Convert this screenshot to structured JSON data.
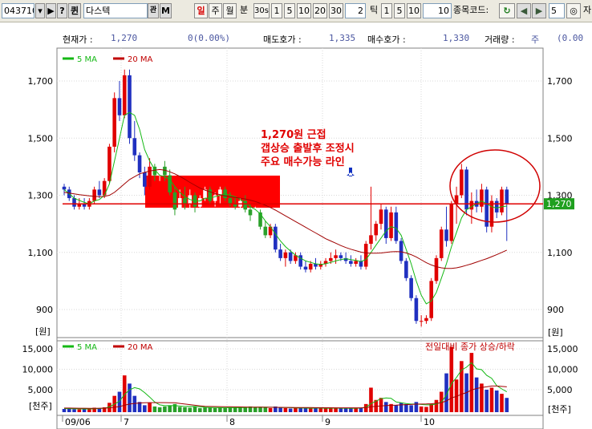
{
  "toolbar": {
    "code_value": "043710",
    "code_buttons": [
      "▾",
      "▶",
      "?",
      "퀸"
    ],
    "stock_name": "다스텍",
    "name_buttons": [
      "관",
      "M"
    ],
    "period_tabs": [
      "일",
      "주",
      "월",
      "분"
    ],
    "interval_30": "30",
    "interval_suffix": "s",
    "intervals": [
      "1",
      "5",
      "10",
      "20",
      "30"
    ],
    "tick_value": "2",
    "tick_label": "틱",
    "tick_intervals": [
      "1",
      "5",
      "10"
    ],
    "count_value": "10",
    "code_label": "종목코드:",
    "refresh_icon": "refresh-icon",
    "nav_prev": "◀",
    "nav_next": "▶",
    "zoom_value": "5",
    "search_icon": "search-icon",
    "tail_label": "자"
  },
  "info": {
    "current_label": "현재가 :",
    "current_value": "1,270",
    "change_value": "0(0.00%)",
    "ask_label": "매도호가 :",
    "ask_value": "1,335",
    "bid_label": "매수호가 :",
    "bid_value": "1,330",
    "volume_label": "거래량 :",
    "volume_value": "주",
    "right_value": "(0.00"
  },
  "annotation": {
    "lines": [
      "1,270원 근접",
      "갭상승 출발후 조정시",
      "주요 매수가능 라인"
    ],
    "price_line": 1270,
    "price_tag": "1,270"
  },
  "chart_data": [
    {
      "type": "candlestick",
      "legend": [
        {
          "name": "5 MA",
          "color": "#14b814"
        },
        {
          "name": "20 MA",
          "color": "#c00000"
        }
      ],
      "y_ticks": [
        900,
        1100,
        1300,
        1500,
        1700
      ],
      "y_tick_labels": [
        "900",
        "1,100",
        "1,300",
        "1,500",
        "1,700"
      ],
      "ylim": [
        830,
        1780
      ],
      "unit_label": "[원]",
      "x_labels": [
        "09/06",
        "7",
        "8",
        "9",
        "10"
      ],
      "colors": {
        "up": "#e00000",
        "down": "#2030c0",
        "ma5": "#14b814",
        "ma20": "#a00000",
        "hline": "#e00000"
      },
      "candles": [
        [
          1330,
          1340,
          1300,
          1320
        ],
        [
          1320,
          1330,
          1280,
          1290
        ],
        [
          1290,
          1300,
          1250,
          1260
        ],
        [
          1260,
          1290,
          1250,
          1270
        ],
        [
          1270,
          1290,
          1250,
          1260
        ],
        [
          1260,
          1290,
          1250,
          1280
        ],
        [
          1280,
          1330,
          1270,
          1320
        ],
        [
          1320,
          1350,
          1290,
          1300
        ],
        [
          1300,
          1360,
          1290,
          1350
        ],
        [
          1350,
          1480,
          1340,
          1470
        ],
        [
          1470,
          1660,
          1450,
          1640
        ],
        [
          1640,
          1700,
          1560,
          1580
        ],
        [
          1580,
          1740,
          1570,
          1720
        ],
        [
          1720,
          1740,
          1480,
          1500
        ],
        [
          1500,
          1560,
          1420,
          1440
        ],
        [
          1440,
          1450,
          1360,
          1380
        ],
        [
          1380,
          1400,
          1300,
          1330
        ],
        [
          1330,
          1430,
          1320,
          1400
        ],
        [
          1400,
          1410,
          1350,
          1370
        ],
        [
          1370,
          1410,
          1350,
          1400
        ],
        [
          1400,
          1420,
          1350,
          1370
        ],
        [
          1370,
          1390,
          1300,
          1310
        ],
        [
          1310,
          1330,
          1230,
          1250
        ],
        [
          1250,
          1320,
          1230,
          1290
        ],
        [
          1290,
          1330,
          1250,
          1270
        ],
        [
          1270,
          1320,
          1250,
          1300
        ],
        [
          1300,
          1310,
          1240,
          1260
        ],
        [
          1260,
          1300,
          1250,
          1290
        ],
        [
          1290,
          1330,
          1280,
          1320
        ],
        [
          1320,
          1330,
          1270,
          1280
        ],
        [
          1280,
          1310,
          1260,
          1300
        ],
        [
          1300,
          1330,
          1270,
          1320
        ],
        [
          1320,
          1330,
          1280,
          1290
        ],
        [
          1290,
          1310,
          1260,
          1270
        ],
        [
          1270,
          1290,
          1250,
          1260
        ],
        [
          1260,
          1290,
          1240,
          1280
        ],
        [
          1280,
          1300,
          1240,
          1250
        ],
        [
          1250,
          1270,
          1210,
          1230
        ],
        [
          1230,
          1260,
          1200,
          1240
        ],
        [
          1240,
          1250,
          1180,
          1190
        ],
        [
          1190,
          1210,
          1150,
          1160
        ],
        [
          1160,
          1200,
          1150,
          1190
        ],
        [
          1190,
          1200,
          1100,
          1110
        ],
        [
          1110,
          1130,
          1070,
          1080
        ],
        [
          1080,
          1110,
          1050,
          1100
        ],
        [
          1100,
          1110,
          1060,
          1070
        ],
        [
          1070,
          1100,
          1060,
          1090
        ],
        [
          1090,
          1100,
          1040,
          1050
        ],
        [
          1050,
          1070,
          1030,
          1040
        ],
        [
          1040,
          1070,
          1030,
          1060
        ],
        [
          1060,
          1080,
          1040,
          1050
        ],
        [
          1050,
          1070,
          1040,
          1060
        ],
        [
          1060,
          1080,
          1050,
          1070
        ],
        [
          1070,
          1100,
          1060,
          1080
        ],
        [
          1080,
          1110,
          1060,
          1090
        ],
        [
          1090,
          1100,
          1070,
          1080
        ],
        [
          1080,
          1100,
          1060,
          1070
        ],
        [
          1070,
          1090,
          1050,
          1060
        ],
        [
          1060,
          1080,
          1050,
          1070
        ],
        [
          1070,
          1090,
          1040,
          1050
        ],
        [
          1050,
          1140,
          1040,
          1130
        ],
        [
          1130,
          1330,
          1110,
          1160
        ],
        [
          1160,
          1210,
          1140,
          1200
        ],
        [
          1200,
          1270,
          1180,
          1250
        ],
        [
          1250,
          1260,
          1130,
          1150
        ],
        [
          1150,
          1260,
          1140,
          1240
        ],
        [
          1240,
          1260,
          1130,
          1140
        ],
        [
          1140,
          1150,
          1060,
          1070
        ],
        [
          1070,
          1080,
          1000,
          1010
        ],
        [
          1010,
          1020,
          930,
          940
        ],
        [
          940,
          950,
          850,
          860
        ],
        [
          860,
          880,
          840,
          860
        ],
        [
          860,
          880,
          850,
          870
        ],
        [
          870,
          1010,
          860,
          1000
        ],
        [
          1000,
          1090,
          990,
          1080
        ],
        [
          1080,
          1190,
          1070,
          1180
        ],
        [
          1180,
          1260,
          1120,
          1140
        ],
        [
          1140,
          1280,
          1130,
          1270
        ],
        [
          1270,
          1330,
          1200,
          1300
        ],
        [
          1300,
          1410,
          1290,
          1390
        ],
        [
          1390,
          1400,
          1230,
          1250
        ],
        [
          1250,
          1310,
          1200,
          1280
        ],
        [
          1280,
          1320,
          1240,
          1260
        ],
        [
          1260,
          1340,
          1240,
          1320
        ],
        [
          1320,
          1330,
          1170,
          1190
        ],
        [
          1190,
          1300,
          1170,
          1280
        ],
        [
          1280,
          1290,
          1220,
          1240
        ],
        [
          1240,
          1330,
          1230,
          1320
        ],
        [
          1320,
          1330,
          1140,
          1270
        ]
      ],
      "ma5": [
        1320,
        1305,
        1290,
        1282,
        1275,
        1270,
        1280,
        1285,
        1300,
        1340,
        1420,
        1500,
        1580,
        1590,
        1580,
        1530,
        1460,
        1420,
        1390,
        1370,
        1365,
        1355,
        1330,
        1310,
        1295,
        1285,
        1280,
        1280,
        1290,
        1290,
        1295,
        1300,
        1305,
        1300,
        1295,
        1285,
        1275,
        1260,
        1250,
        1235,
        1210,
        1190,
        1165,
        1140,
        1120,
        1105,
        1090,
        1080,
        1070,
        1065,
        1060,
        1058,
        1060,
        1065,
        1070,
        1075,
        1078,
        1075,
        1072,
        1068,
        1075,
        1100,
        1125,
        1150,
        1175,
        1190,
        1185,
        1160,
        1110,
        1060,
        1000,
        950,
        920,
        930,
        960,
        1010,
        1060,
        1120,
        1170,
        1220,
        1250,
        1260,
        1270,
        1280,
        1270,
        1260,
        1255,
        1260,
        1262
      ],
      "ma20": [
        1310,
        1308,
        1305,
        1302,
        1300,
        1298,
        1296,
        1295,
        1296,
        1300,
        1310,
        1325,
        1340,
        1355,
        1365,
        1375,
        1380,
        1385,
        1388,
        1390,
        1388,
        1382,
        1375,
        1366,
        1356,
        1345,
        1335,
        1325,
        1318,
        1312,
        1306,
        1302,
        1298,
        1295,
        1292,
        1290,
        1287,
        1283,
        1278,
        1272,
        1265,
        1257,
        1248,
        1238,
        1228,
        1218,
        1208,
        1198,
        1188,
        1178,
        1168,
        1158,
        1148,
        1140,
        1132,
        1124,
        1117,
        1111,
        1106,
        1101,
        1098,
        1097,
        1097,
        1098,
        1100,
        1102,
        1103,
        1102,
        1098,
        1092,
        1084,
        1074,
        1064,
        1056,
        1050,
        1046,
        1044,
        1044,
        1046,
        1050,
        1055,
        1060,
        1066,
        1072,
        1078,
        1085,
        1092,
        1100,
        1108
      ]
    },
    {
      "type": "bar",
      "legend": [
        {
          "name": "5 MA",
          "color": "#14b814"
        },
        {
          "name": "20 MA",
          "color": "#c00000"
        }
      ],
      "note": "전일대비 종가 상승/하락",
      "y_ticks": [
        5000,
        10000,
        15000
      ],
      "y_tick_labels": [
        "5,000",
        "10,000",
        "15,000"
      ],
      "ylim": [
        0,
        16500
      ],
      "unit_label": "[천주]",
      "volumes": [
        300,
        500,
        250,
        200,
        300,
        250,
        600,
        500,
        700,
        1800,
        3500,
        4500,
        8500,
        6500,
        3500,
        2000,
        1200,
        1800,
        900,
        700,
        900,
        1200,
        1500,
        800,
        700,
        600,
        900,
        500,
        700,
        600,
        500,
        600,
        500,
        700,
        600,
        800,
        600,
        900,
        700,
        800,
        700,
        500,
        900,
        600,
        500,
        400,
        500,
        600,
        500,
        400,
        600,
        500,
        400,
        500,
        600,
        400,
        500,
        400,
        500,
        600,
        1500,
        5500,
        2500,
        3000,
        2000,
        1500,
        1200,
        1800,
        1500,
        1200,
        2000,
        900,
        800,
        1500,
        2500,
        4500,
        9000,
        15500,
        7500,
        12000,
        9000,
        14000,
        8000,
        6500,
        5000,
        5500,
        4800,
        4000,
        3000
      ],
      "vol_ma5": [
        400,
        380,
        350,
        320,
        300,
        300,
        350,
        400,
        450,
        800,
        1500,
        2200,
        3800,
        5000,
        5500,
        5200,
        4300,
        3200,
        2000,
        1300,
        1100,
        1100,
        1100,
        1000,
        900,
        950,
        900,
        800,
        700,
        650,
        650,
        600,
        600,
        600,
        600,
        650,
        650,
        700,
        700,
        750,
        750,
        700,
        700,
        650,
        650,
        600,
        550,
        550,
        500,
        480,
        500,
        500,
        480,
        480,
        500,
        480,
        480,
        460,
        480,
        500,
        700,
        1600,
        2200,
        2800,
        3000,
        2900,
        2000,
        1800,
        1600,
        1500,
        1500,
        1400,
        1300,
        1300,
        1500,
        2000,
        3700,
        6500,
        8000,
        9800,
        10500,
        11600,
        10100,
        9900,
        8500,
        7800,
        6000,
        5200,
        4500
      ],
      "vol_ma20": [
        500,
        500,
        490,
        480,
        470,
        460,
        460,
        470,
        490,
        560,
        700,
        880,
        1200,
        1500,
        1650,
        1750,
        1800,
        1850,
        1850,
        1850,
        1850,
        1830,
        1800,
        1650,
        1500,
        1350,
        1200,
        1050,
        950,
        900,
        880,
        860,
        840,
        820,
        800,
        780,
        760,
        740,
        730,
        720,
        710,
        700,
        690,
        680,
        670,
        660,
        650,
        640,
        630,
        620,
        610,
        600,
        590,
        580,
        570,
        560,
        560,
        560,
        560,
        570,
        620,
        830,
        920,
        1030,
        1110,
        1170,
        1220,
        1290,
        1350,
        1400,
        1480,
        1500,
        1510,
        1560,
        1660,
        1850,
        2250,
        3000,
        3350,
        3900,
        4300,
        4950,
        5300,
        5550,
        5700,
        5900,
        5900,
        5800,
        5700
      ]
    }
  ]
}
